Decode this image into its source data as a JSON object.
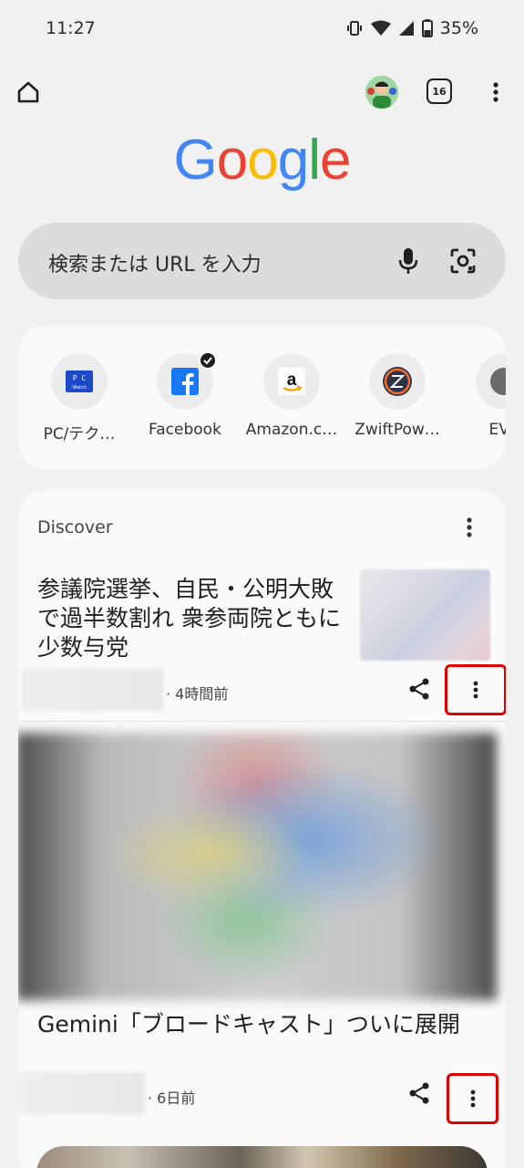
{
  "status_bar": {
    "time": "11:27",
    "battery": "35%",
    "icons": [
      "vibrate-icon",
      "wifi-icon",
      "signal-icon",
      "battery-icon"
    ]
  },
  "toolbar": {
    "tab_count": "16",
    "icons": [
      "home-icon",
      "avatar",
      "tab-switcher-icon",
      "more-vert-icon"
    ]
  },
  "logo": {
    "letters": [
      "G",
      "o",
      "o",
      "g",
      "l",
      "e"
    ],
    "colors": [
      "#4285F4",
      "#EA4335",
      "#FBBC05",
      "#4285F4",
      "#34A853",
      "#EA4335"
    ]
  },
  "search": {
    "placeholder": "検索または URL を入力",
    "icons": [
      "mic-icon",
      "google-lens-icon"
    ]
  },
  "shortcuts": [
    {
      "label": "PC/テク…",
      "icon": "pc-watch-icon"
    },
    {
      "label": "Facebook",
      "icon": "facebook-icon"
    },
    {
      "label": "Amazon.c…",
      "icon": "amazon-icon"
    },
    {
      "label": "ZwiftPow…",
      "icon": "zwiftpower-icon"
    },
    {
      "label": "EVA",
      "icon": "eva-icon"
    }
  ],
  "discover": {
    "title": "Discover",
    "articles": [
      {
        "title": "参議院選挙、自民・公明大敗で過半数割れ 衆参両院ともに少数与党",
        "time": "· 4時間前"
      },
      {
        "title": "Gemini「ブロードキャスト」ついに展開",
        "time": "· 6日前"
      }
    ]
  },
  "colors": {
    "background": "#f1f1f1",
    "card": "#fafafa",
    "search_bg": "#dcdcdc",
    "highlight": "#e00000"
  }
}
